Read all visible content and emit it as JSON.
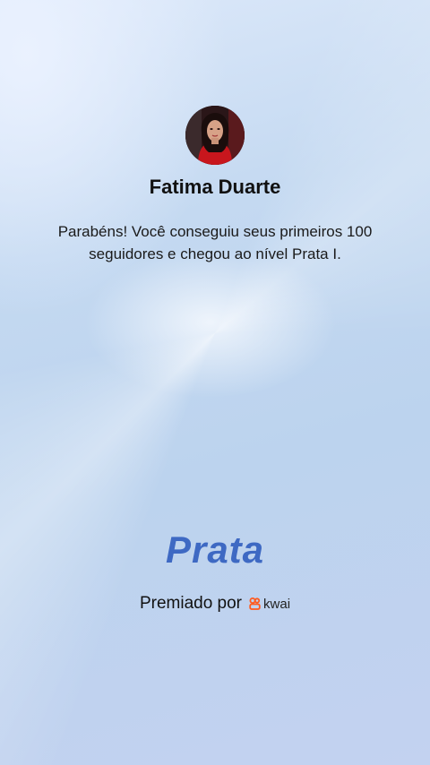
{
  "profile": {
    "avatar_icon": "user-avatar-photo",
    "name": "Fatima Duarte"
  },
  "message": "Parabéns! Você conseguiu seus primeiros 100 seguidores e chegou ao nível Prata I.",
  "level": {
    "label": "Prata",
    "color": "#3e69c3"
  },
  "footer": {
    "awarded_by": "Premiado por",
    "brand": "kwai",
    "brand_icon": "kwai-logo-icon",
    "brand_color": "#ff5a1f"
  }
}
